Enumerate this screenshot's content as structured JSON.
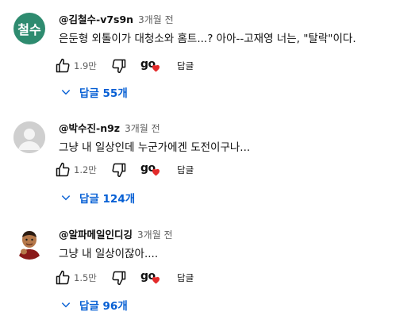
{
  "colors": {
    "link": "#065fd4",
    "heart": "#e32a2a",
    "avatar_green": "#2e8b6f"
  },
  "comments": [
    {
      "avatar_text": "철수",
      "handle": "@김철수-v7s9n",
      "time": "3개월 전",
      "text": "은둔형 외톨이가 대청소와 홈트...? 아아--고재영 너는, \"탈락\"이다.",
      "likes": "1.9만",
      "creator_heart_label": "go",
      "reply_label": "답글",
      "replies_label": "답글 55개"
    },
    {
      "avatar_text": "",
      "handle": "@박수진-n9z",
      "time": "3개월 전",
      "text": "그냥 내 일상인데 누군가에겐 도전이구나...",
      "likes": "1.2만",
      "creator_heart_label": "go",
      "reply_label": "답글",
      "replies_label": "답글 124개"
    },
    {
      "avatar_text": "",
      "handle": "@알파메일인디깅",
      "time": "3개월 전",
      "text": "그냥 내 일상이잖아....",
      "likes": "1.5만",
      "creator_heart_label": "go",
      "reply_label": "답글",
      "replies_label": "답글 96개"
    }
  ]
}
